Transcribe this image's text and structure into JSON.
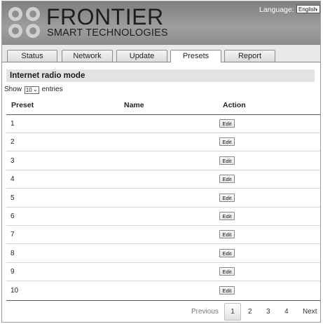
{
  "header": {
    "brand_big": "FRONTIER",
    "brand_small": "SMART TECHNOLOGIES",
    "logo_icon": "frontier-dots-logo",
    "language_label": "Language:",
    "language_value": "English"
  },
  "tabs": [
    {
      "label": "Status",
      "active": false
    },
    {
      "label": "Network",
      "active": false
    },
    {
      "label": "Update",
      "active": false
    },
    {
      "label": "Presets",
      "active": true
    },
    {
      "label": "Report",
      "active": false
    }
  ],
  "section": {
    "title": "Internet radio mode"
  },
  "length_menu": {
    "show": "Show",
    "value": "10",
    "entries": "entries"
  },
  "table": {
    "columns": [
      "Preset",
      "Name",
      "Action"
    ],
    "rows": [
      {
        "preset": "1",
        "name": "",
        "action": "Edit"
      },
      {
        "preset": "2",
        "name": "",
        "action": "Edit"
      },
      {
        "preset": "3",
        "name": "",
        "action": "Edit"
      },
      {
        "preset": "4",
        "name": "",
        "action": "Edit"
      },
      {
        "preset": "5",
        "name": "",
        "action": "Edit"
      },
      {
        "preset": "6",
        "name": "",
        "action": "Edit"
      },
      {
        "preset": "7",
        "name": "",
        "action": "Edit"
      },
      {
        "preset": "8",
        "name": "",
        "action": "Edit"
      },
      {
        "preset": "9",
        "name": "",
        "action": "Edit"
      },
      {
        "preset": "10",
        "name": "",
        "action": "Edit"
      }
    ]
  },
  "pagination": {
    "previous": "Previous",
    "pages": [
      "1",
      "2",
      "3",
      "4"
    ],
    "current": "1",
    "next": "Next"
  }
}
